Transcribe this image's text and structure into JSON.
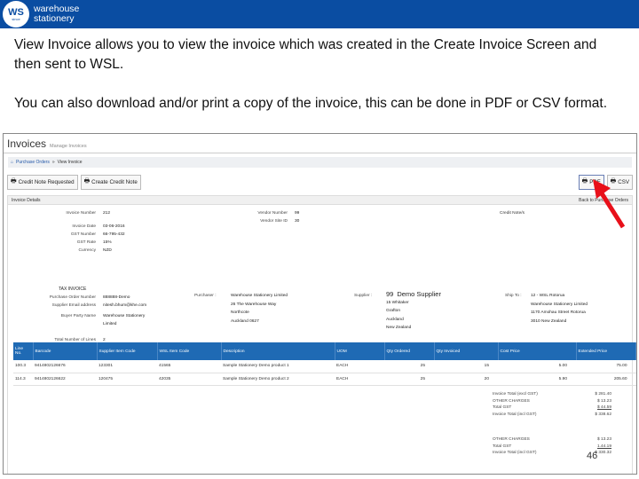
{
  "brand": {
    "logo_mark": "WS",
    "logo_small": "since",
    "line1": "warehouse",
    "line2": "stationery"
  },
  "slide": {
    "paragraph1": "View Invoice allows you to view the invoice which was created in the Create Invoice Screen and then sent to WSL.",
    "paragraph2": "You can also download and/or print a copy of the invoice, this can be done in PDF or CSV format.",
    "page_number": "46"
  },
  "colors": {
    "header_blue": "#0a4da2",
    "table_header": "#1f6ab4",
    "arrow_red": "#e8101a"
  },
  "app": {
    "title": "Invoices",
    "subtitle": "Manage Invoices",
    "breadcrumb": {
      "home": "Purchase Orders",
      "separator": "»",
      "current": "View Invoice"
    },
    "toolbar": {
      "credit_note_requested": "Credit Note Requested",
      "create_credit_note": "Create Credit Note",
      "pdf": "PDF",
      "csv": "CSV",
      "icons": [
        "printer-icon",
        "printer-icon",
        "printer-icon",
        "printer-icon"
      ]
    },
    "panel": {
      "title": "Invoice Details",
      "back": "Back to Purchase Orders"
    },
    "invoice_fields": [
      {
        "label": "Invoice Number",
        "value": "212"
      },
      {
        "label": "Invoice Date",
        "value": "03-06-2016"
      },
      {
        "label": "GST Number",
        "value": "66-795-432"
      },
      {
        "label": "GST Rate",
        "value": "15%"
      },
      {
        "label": "Currency",
        "value": "NZD"
      }
    ],
    "vendor_fields": [
      {
        "label": "Vendor Number",
        "value": "99"
      },
      {
        "label": "Vendor Site ID",
        "value": "30"
      }
    ],
    "credit_notes_label": "Credit Note/s",
    "tax_invoice_title": "TAX INVOICE",
    "tax_fields": [
      {
        "label": "Purchase Order Number",
        "value": "888888-Demo"
      },
      {
        "label": "Supplier Email address",
        "value": "nitesh.bhum@khe.com"
      },
      {
        "label": "Buyer Party Name",
        "value": "Warehouse Stationery Limited"
      },
      {
        "label": "Total Number of Lines",
        "value": "2"
      }
    ],
    "purchaser": {
      "label": "Purchaser :",
      "lines": [
        "Warehouse Stationery Limited",
        "26 The Warehouse Way",
        "Northcote",
        "Auckland 0627"
      ]
    },
    "supplier": {
      "label": "Supplier :",
      "number": "99",
      "name": "Demo Supplier",
      "lines": [
        "15 Whitaker",
        "Grafton",
        "Auckland",
        "New Zealand"
      ]
    },
    "ship_to": {
      "label": "Ship To :",
      "lines": [
        "12 - WSL Rotorua",
        "Warehouse Stationery Limited",
        "1170 Amohau Street Rotorua",
        "3010 New Zealand"
      ]
    },
    "table": {
      "headers": [
        "Line No.",
        "Barcode",
        "Supplier Item Code",
        "WSL Item Code",
        "Description",
        "UOM",
        "Qty Ordered",
        "Qty Invoiced",
        "Cost Price",
        "Extended Price"
      ],
      "rows": [
        [
          "100.3",
          "9414802126676",
          "123301",
          "41565",
          "Sample Stationery Demo product 1",
          "EACH",
          "25",
          "15",
          "5.00",
          "75.00"
        ],
        [
          "114.3",
          "9414802126622",
          "120475",
          "42035",
          "Sample Stationery Demo product 2",
          "EACH",
          "25",
          "20",
          "5.90",
          "205.60"
        ]
      ]
    },
    "totals": [
      {
        "label": "Invoice Total (excl GST)",
        "value": "$ 281.40"
      },
      {
        "label": "OTHER CHARGES",
        "value": "$ 13.23"
      },
      {
        "label": "Total GST",
        "value": "$ 44.59"
      },
      {
        "label": "Invoice Total (incl GST)",
        "value": "$ 338.62"
      }
    ],
    "totals_repeat": [
      {
        "label": "OTHER CHARGES",
        "value": "$ 13.23"
      },
      {
        "label": "Total GST",
        "value": "1.44.19"
      },
      {
        "label": "Invoice Total (incl GST)",
        "value": "$ 330.32"
      }
    ]
  }
}
